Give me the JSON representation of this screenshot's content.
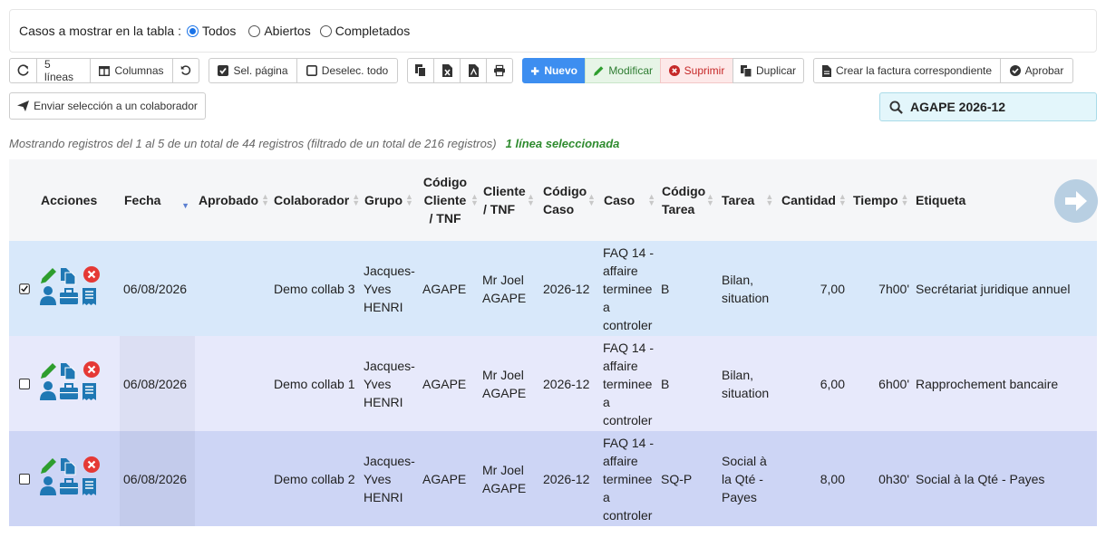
{
  "filter": {
    "label": "Casos a mostrar en la tabla :",
    "options": [
      {
        "label": "Todos",
        "selected": true
      },
      {
        "label": "Abiertos",
        "selected": false
      },
      {
        "label": "Completados",
        "selected": false
      }
    ]
  },
  "toolbar": {
    "refresh_icon": "refresh-icon",
    "lines_label": "5 líneas",
    "columns_label": "Columnas",
    "select_page_label": "Sel. página",
    "deselect_all_label": "Deselec. todo",
    "new_label": "Nuevo",
    "modify_label": "Modificar",
    "delete_label": "Suprimir",
    "duplicate_label": "Duplicar",
    "invoice_label": "Crear la factura correspondiente",
    "approve_label": "Aprobar",
    "send_label": "Enviar selección a un colaborador"
  },
  "search": {
    "value": "AGAPE 2026-12"
  },
  "info": {
    "records_text": "Mostrando registros del 1 al 5 de un total de 44 registros (filtrado de un total de 216 registros)",
    "selected_text": "1 línea seleccionada"
  },
  "columns": {
    "acciones": "Acciones",
    "fecha": "Fecha",
    "aprobado": "Aprobado",
    "colaborador": "Colaborador",
    "grupo": "Grupo",
    "codigo_cliente": "Código Cliente / TNF",
    "cliente": "Cliente / TNF",
    "codigo_caso": "Código Caso",
    "caso": "Caso",
    "codigo_tarea": "Código Tarea",
    "tarea": "Tarea",
    "cantidad": "Cantidad",
    "tiempo": "Tiempo",
    "etiqueta": "Etiqueta"
  },
  "rows": [
    {
      "checked": true,
      "fecha": "06/08/2026",
      "aprobado": "",
      "colaborador": "Demo collab 3",
      "grupo": "Jacques-Yves HENRI",
      "codigo_cliente": "AGAPE",
      "cliente": "Mr Joel AGAPE",
      "codigo_caso": "2026-12",
      "caso": "FAQ 14 - affaire terminee a controler",
      "codigo_tarea": "B",
      "tarea": "Bilan, situation",
      "cantidad": "7,00",
      "tiempo": "7h00'",
      "etiqueta": "Secrétariat juridique annuel"
    },
    {
      "checked": false,
      "fecha": "06/08/2026",
      "aprobado": "",
      "colaborador": "Demo collab 1",
      "grupo": "Jacques-Yves HENRI",
      "codigo_cliente": "AGAPE",
      "cliente": "Mr Joel AGAPE",
      "codigo_caso": "2026-12",
      "caso": "FAQ 14 - affaire terminee a controler",
      "codigo_tarea": "B",
      "tarea": "Bilan, situation",
      "cantidad": "6,00",
      "tiempo": "6h00'",
      "etiqueta": "Rapprochement bancaire"
    },
    {
      "checked": false,
      "fecha": "06/08/2026",
      "aprobado": "",
      "colaborador": "Demo collab 2",
      "grupo": "Jacques-Yves HENRI",
      "codigo_cliente": "AGAPE",
      "cliente": "Mr Joel AGAPE",
      "codigo_caso": "2026-12",
      "caso": "FAQ 14 - affaire terminee a controler",
      "codigo_tarea": "SQ-P",
      "tarea": "Social à la Qté - Payes",
      "cantidad": "8,00",
      "tiempo": "0h30'",
      "etiqueta": "Social à la Qté - Payes"
    }
  ],
  "colors": {
    "accent": "#3d8ef0",
    "selected_row": "#d8e8fa",
    "row_alt": "#e7e9fb",
    "row_alt2": "#cdd5f5",
    "icon_green": "#2e9e2e",
    "icon_blue": "#1f78b4",
    "icon_red": "#e53935"
  }
}
